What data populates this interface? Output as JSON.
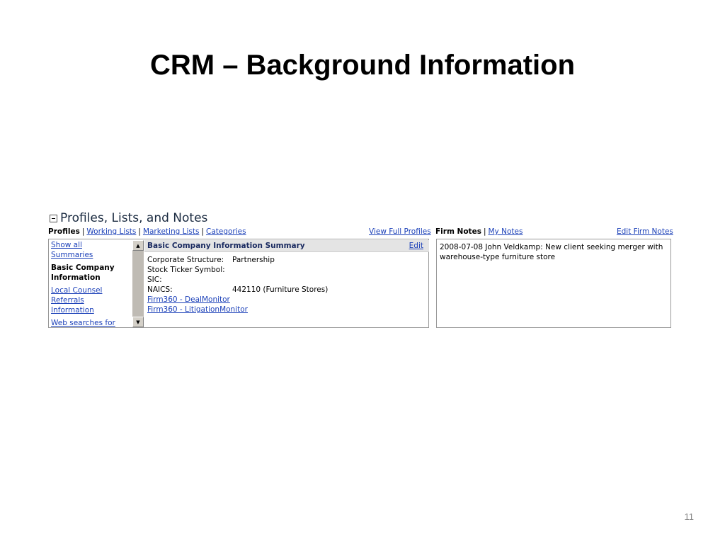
{
  "slide": {
    "title": "CRM – Background Information",
    "number": "11"
  },
  "panel": {
    "title": "Profiles, Lists, and Notes",
    "left_tabs": {
      "profiles": "Profiles",
      "working_lists": "Working Lists",
      "marketing_lists": "Marketing Lists",
      "categories": "Categories",
      "separator": "|"
    },
    "view_full_profiles": "View Full Profiles",
    "right_tabs": {
      "firm_notes": "Firm Notes",
      "my_notes": "My Notes",
      "edit_firm_notes": "Edit Firm Notes"
    },
    "nav": {
      "items": [
        {
          "label": "Show all",
          "link": true
        },
        {
          "label": "Summaries",
          "link": true
        },
        {
          "label": "Basic Company",
          "link": false
        },
        {
          "label": "Information",
          "link": false
        },
        {
          "label": "Local Counsel",
          "link": true
        },
        {
          "label": "Referrals",
          "link": true
        },
        {
          "label": "Information",
          "link": true
        },
        {
          "label": "Web searches for",
          "link": true
        }
      ]
    },
    "summary": {
      "header": "Basic Company Information Summary",
      "edit": "Edit",
      "fields": [
        {
          "label": "Corporate Structure:",
          "value": "Partnership"
        },
        {
          "label": "Stock Ticker Symbol:",
          "value": ""
        },
        {
          "label": "SIC:",
          "value": ""
        },
        {
          "label": "NAICS:",
          "value": "442110 (Furniture Stores)"
        }
      ],
      "links": [
        "Firm360 - DealMonitor",
        "Firm360 - LitigationMonitor"
      ]
    },
    "notes": {
      "text": "2008-07-08 John Veldkamp: New client seeking merger with warehouse-type furniture store"
    }
  },
  "colors": {
    "link": "#1a3fb8",
    "scrollbar": "#d4d0c8",
    "header_bg": "#e4e4e4"
  }
}
